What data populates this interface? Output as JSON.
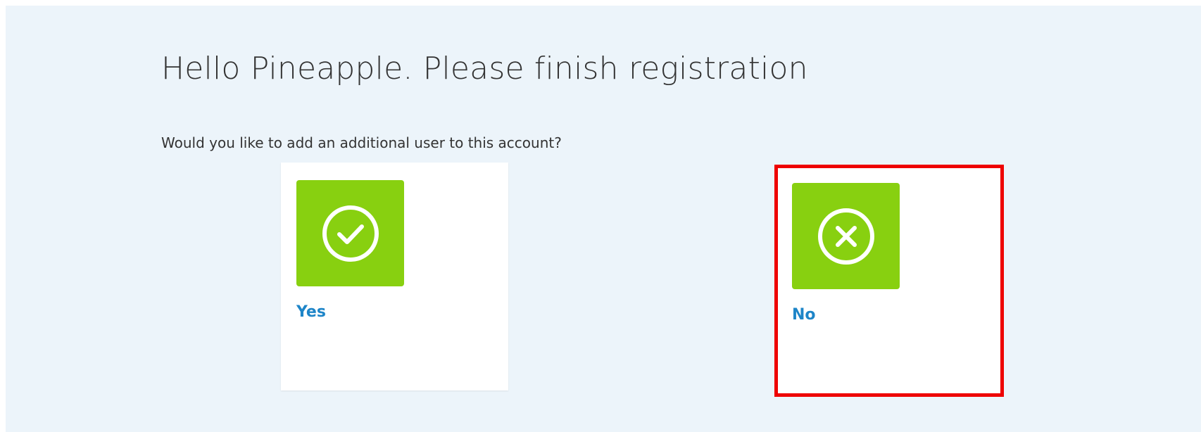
{
  "page": {
    "title": "Hello Pineapple. Please finish registration",
    "question": "Would you like to add an additional user to this account?"
  },
  "options": {
    "yes": {
      "label": "Yes",
      "icon": "check-circle-icon"
    },
    "no": {
      "label": "No",
      "icon": "x-circle-icon"
    }
  },
  "colors": {
    "panel_background": "#ecf4fa",
    "icon_tile": "#88d010",
    "label": "#1e85c8",
    "highlight_border": "#ee0000"
  }
}
